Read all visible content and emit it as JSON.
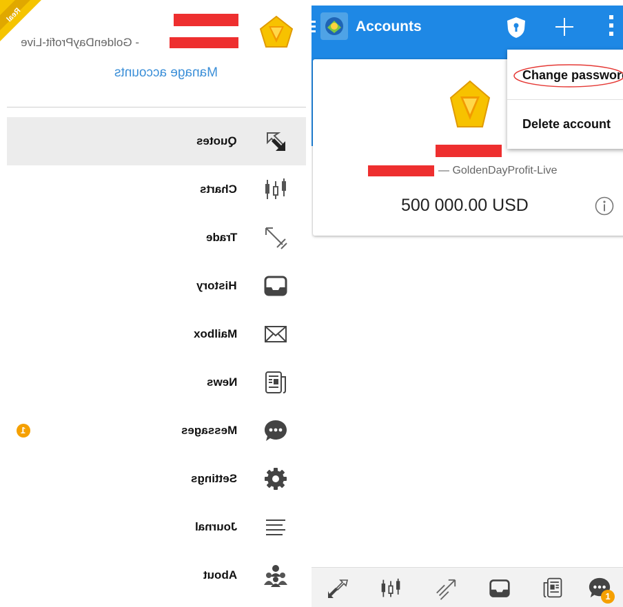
{
  "drawer": {
    "account_server": "GoldenDayProfit-Live",
    "server_separator": "- ",
    "ribbon_label": "Real",
    "manage_accounts": "Manage accounts",
    "items": [
      {
        "label": "Quotes",
        "icon": "quotes-arrows-icon",
        "selected": true
      },
      {
        "label": "Charts",
        "icon": "candlestick-chart-icon"
      },
      {
        "label": "Trade",
        "icon": "trade-arrows-icon"
      },
      {
        "label": "History",
        "icon": "history-inbox-icon"
      },
      {
        "label": "Mailbox",
        "icon": "mail-envelope-icon"
      },
      {
        "label": "News",
        "icon": "news-document-icon"
      },
      {
        "label": "Messages",
        "icon": "messages-chat-icon",
        "badge": "1"
      },
      {
        "label": "Settings",
        "icon": "settings-gear-icon"
      },
      {
        "label": "Journal",
        "icon": "journal-lines-icon"
      },
      {
        "label": "About",
        "icon": "about-people-icon"
      }
    ]
  },
  "appbar": {
    "title": "Accounts",
    "icons": [
      "menu-icon",
      "metatrader-app-icon",
      "shield-icon",
      "add-icon",
      "overflow-menu-icon"
    ]
  },
  "account_card": {
    "server": "GoldenDayProfit-Live",
    "separator": "— ",
    "balance": "500 000.00 USD",
    "info_icon": "info-icon"
  },
  "overflow_menu": {
    "items": [
      "Change password",
      "Delete account"
    ]
  },
  "bottom_nav": {
    "icons": [
      "quotes-icon",
      "charts-icon",
      "trade-icon",
      "history-icon",
      "news-icon",
      "messages-icon"
    ],
    "messages_badge": "1"
  },
  "colors": {
    "primary": "#1e88e5",
    "link": "#3b8fd8",
    "redaction": "#ee2f2f",
    "badge": "#f5a000",
    "logo_gold": "#f7c200"
  }
}
